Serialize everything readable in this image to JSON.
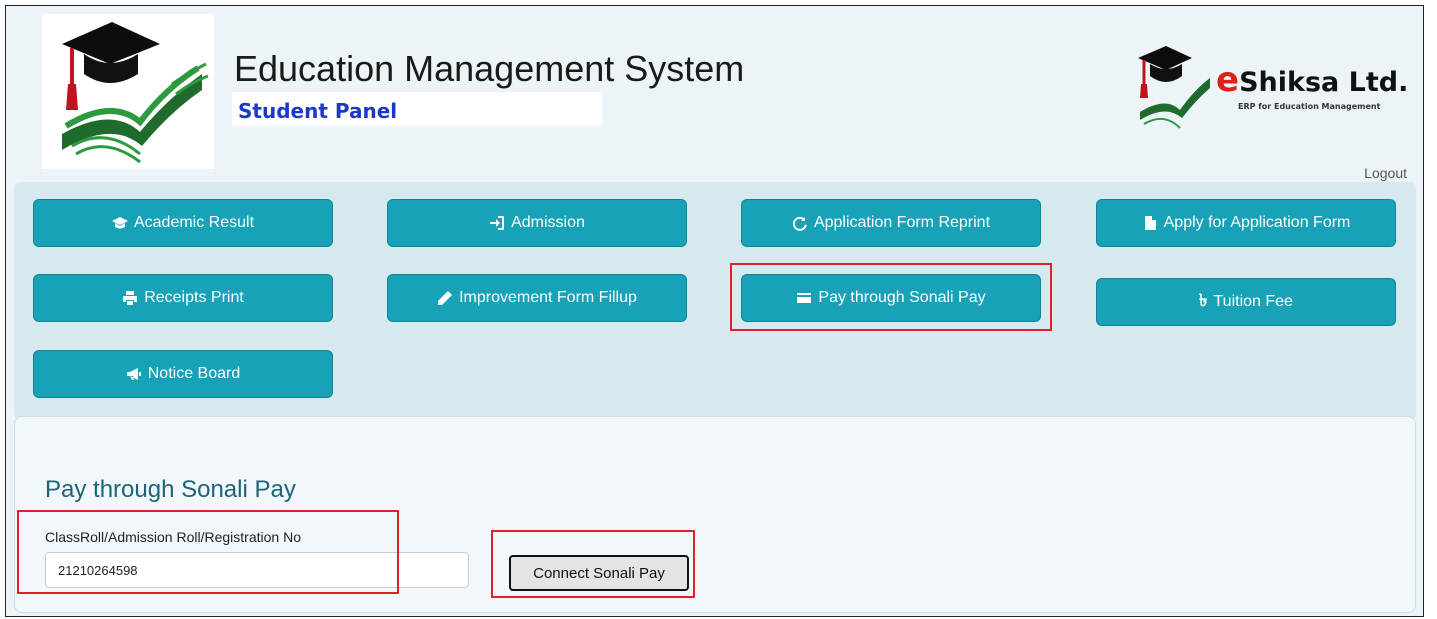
{
  "header": {
    "title": "Education Management System",
    "subtitle": "Student Panel",
    "brand": {
      "name_e": "e",
      "name_rest": "Shiksa Ltd.",
      "tagline": "ERP for Education Management"
    },
    "logout_label": "Logout"
  },
  "nav": {
    "academic_result": "Academic Result",
    "admission": "Admission",
    "application_form_reprint": "Application Form Reprint",
    "apply_for_application_form": "Apply for Application Form",
    "receipts_print": "Receipts Print",
    "improvement_form_fillup": "Improvement Form Fillup",
    "pay_through_sonali_pay": "Pay through Sonali Pay",
    "tuition_fee": "Tuition Fee",
    "taka_symbol": "৳",
    "notice_board": "Notice Board"
  },
  "payment": {
    "heading": "Pay through Sonali Pay",
    "field_label": "ClassRoll/Admission Roll/Registration No",
    "roll_value": "21210264598",
    "connect_label": "Connect Sonali Pay"
  },
  "colors": {
    "button_bg": "#17a2b8",
    "highlight": "#e0202a",
    "heading": "#1d6477",
    "subtitle": "#1c38c8"
  },
  "icons": {
    "academic_result": "graduation-cap-icon",
    "admission": "sign-in-icon",
    "application_form_reprint": "refresh-icon",
    "apply_for_application_form": "file-icon",
    "receipts_print": "print-icon",
    "improvement_form_fillup": "pencil-icon",
    "pay_through_sonali_pay": "credit-card-icon",
    "tuition_fee": "taka-icon",
    "notice_board": "bullhorn-icon"
  }
}
